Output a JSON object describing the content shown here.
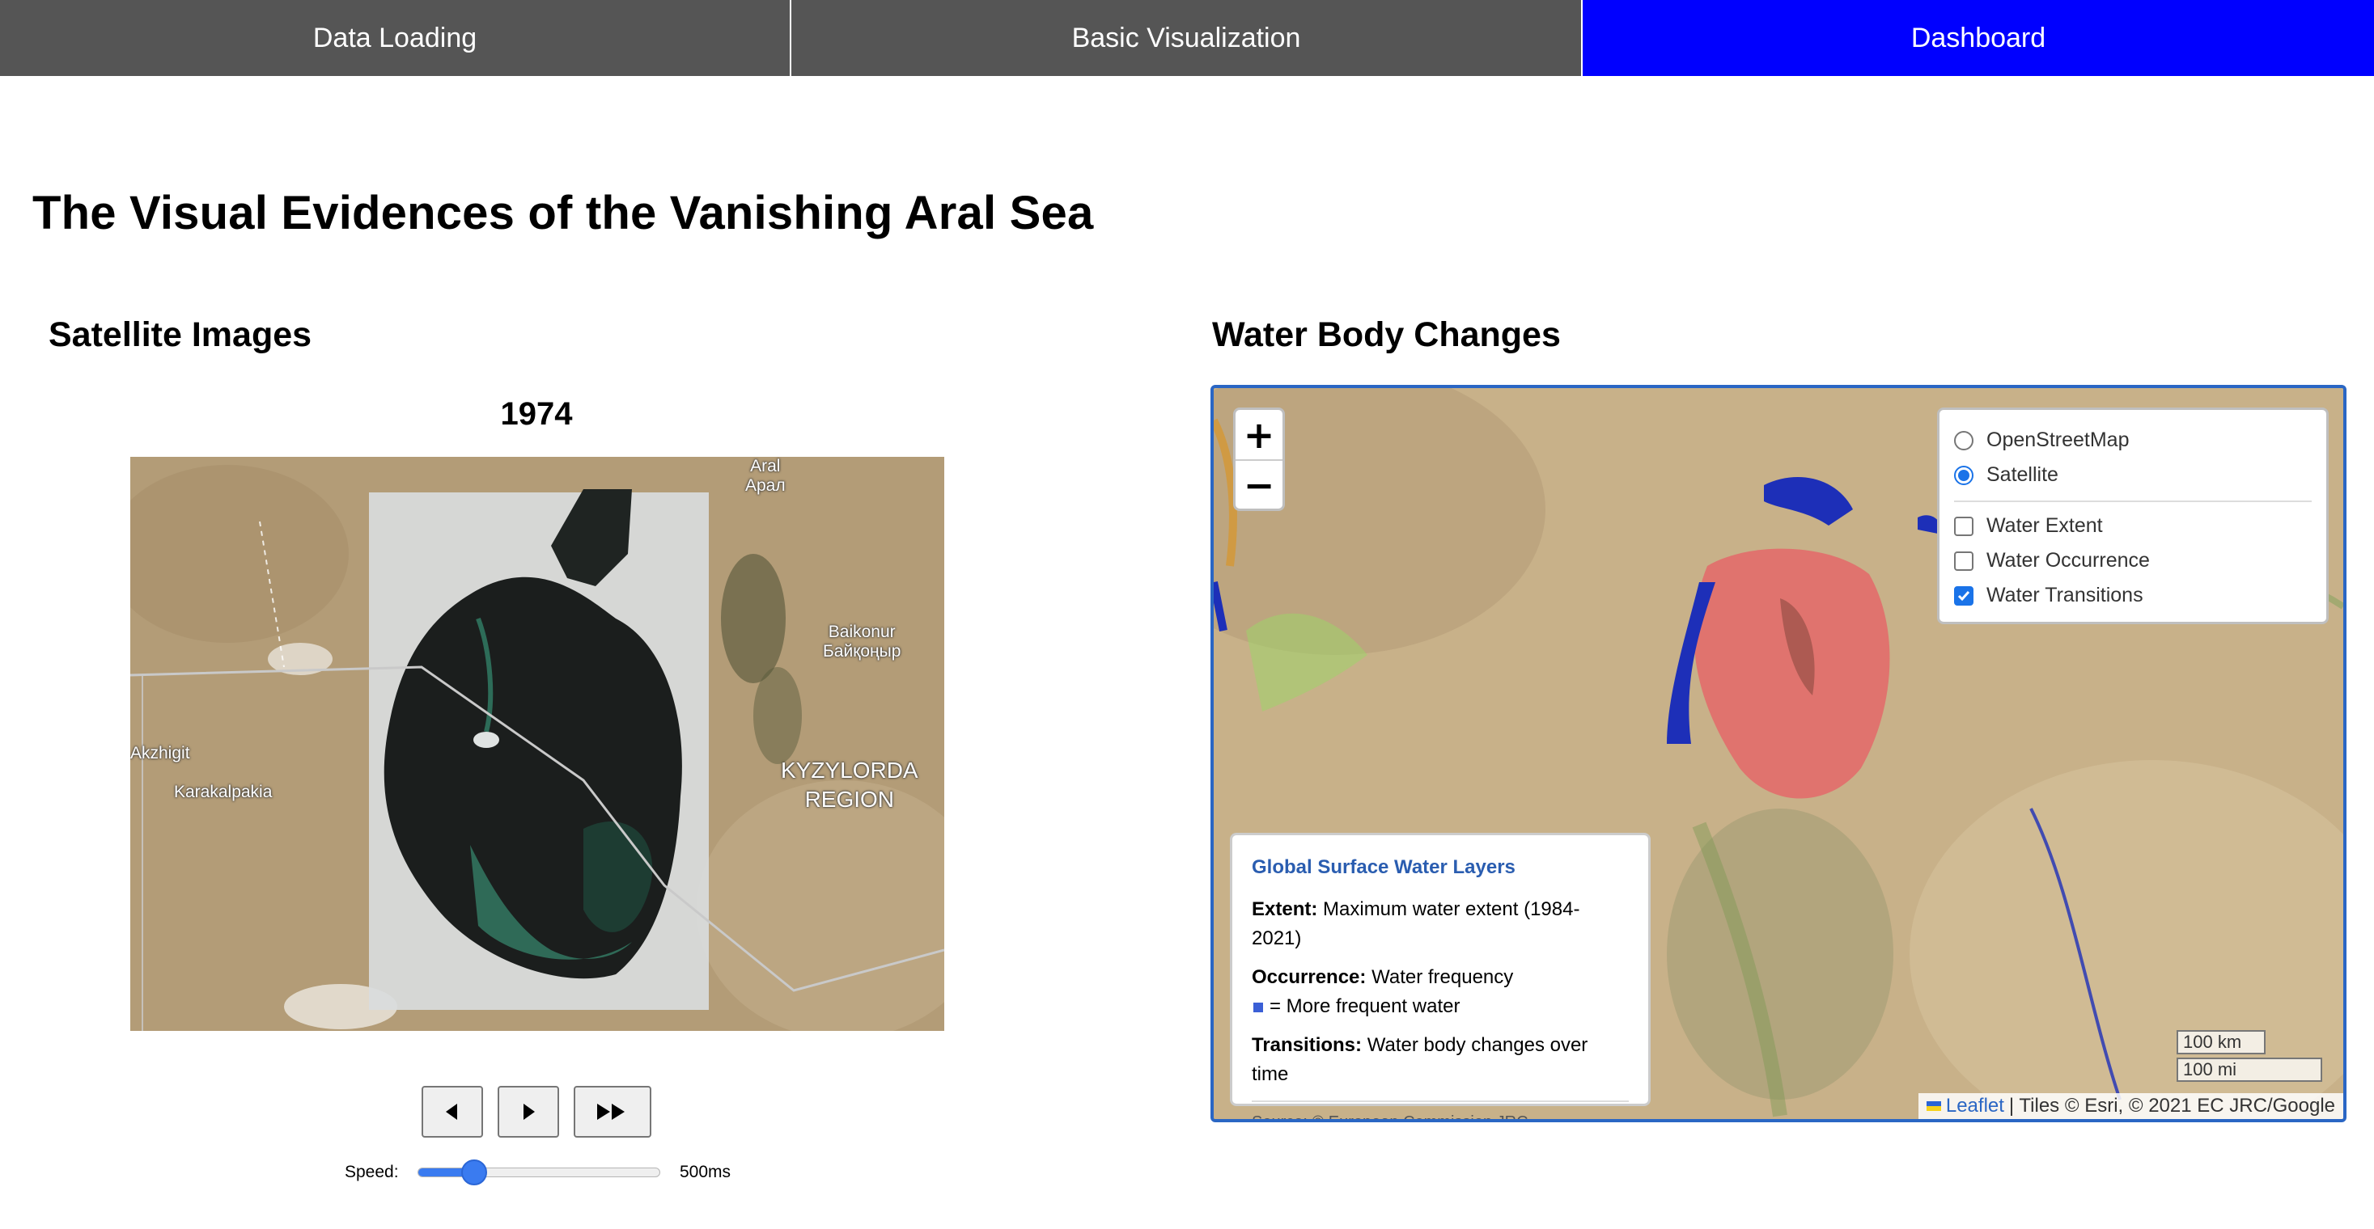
{
  "nav": {
    "tabs": [
      {
        "label": "Data Loading",
        "active": false
      },
      {
        "label": "Basic Visualization",
        "active": false
      },
      {
        "label": "Dashboard",
        "active": true
      }
    ],
    "active_color": "#0000ff",
    "inactive_color": "#555555"
  },
  "page": {
    "title": "The Visual Evidences of the Vanishing Aral Sea"
  },
  "satellite": {
    "heading": "Satellite Images",
    "year": "1974",
    "map_labels": {
      "aral": "Aral",
      "aral_cyr": "Арал",
      "baikonur": "Baikonur",
      "baikonur_cyr": "Байқоңыр",
      "akzhigit": "Akzhigit",
      "karakalpakia": "Karakalpakia",
      "region_line1": "KYZYLORDA",
      "region_line2": "REGION"
    },
    "controls": {
      "prev_icon": "step-back-icon",
      "play_icon": "play-icon",
      "fast_forward_icon": "fast-forward-icon"
    },
    "speed": {
      "label": "Speed:",
      "value_text": "500ms",
      "slider_fraction": 0.23
    }
  },
  "water": {
    "heading": "Water Body Changes",
    "zoom": {
      "in": "+",
      "out": "−"
    },
    "base_layers": [
      {
        "label": "OpenStreetMap",
        "selected": false
      },
      {
        "label": "Satellite",
        "selected": true
      }
    ],
    "overlays": [
      {
        "label": "Water Extent",
        "checked": false
      },
      {
        "label": "Water Occurrence",
        "checked": false
      },
      {
        "label": "Water Transitions",
        "checked": true
      }
    ],
    "legend": {
      "title": "Global Surface Water Layers",
      "extent_key": "Extent:",
      "extent_text": "Maximum water extent (1984-2021)",
      "occurrence_key": "Occurrence:",
      "occurrence_text": "Water frequency",
      "occurrence_note": "= More frequent water",
      "transitions_key": "Transitions:",
      "transitions_text": "Water body changes over time",
      "source": "Source: © European Commission JRC"
    },
    "scale": {
      "km": "100 km",
      "mi": "100 mi"
    },
    "attribution": {
      "leaflet": "Leaflet",
      "rest": "| Tiles © Esri, © 2021 EC JRC/Google"
    }
  }
}
